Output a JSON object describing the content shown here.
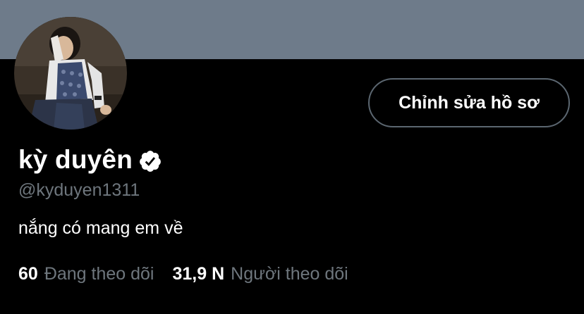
{
  "profile": {
    "display_name": "kỳ duyên",
    "handle": "@kyduyen1311",
    "bio": "nắng có mang em về",
    "verified_icon": "verified-badge-icon"
  },
  "actions": {
    "edit_profile_label": "Chỉnh sửa hồ sơ"
  },
  "stats": {
    "following_count": "60",
    "following_label": "Đang theo dõi",
    "followers_count": "31,9 N",
    "followers_label": "Người theo dõi"
  },
  "colors": {
    "background": "#000000",
    "banner": "#6e7b8a",
    "secondary_text": "#6e767d",
    "button_border": "#5b6670"
  }
}
